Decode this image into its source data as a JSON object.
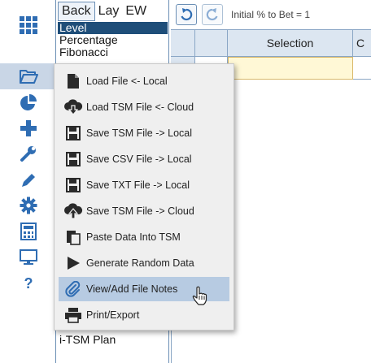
{
  "left_toolbar": {
    "icons": [
      "apps-grid-icon",
      "folder-open-icon",
      "pie-chart-icon",
      "plus-icon",
      "wrench-icon",
      "pencil-icon",
      "gear-icon",
      "calculator-icon",
      "monitor-icon",
      "help-icon"
    ]
  },
  "mode_tabs": {
    "back": "Back",
    "lay": "Lay",
    "ew": "EW"
  },
  "sizing_options": [
    "Level",
    "Percentage",
    "Fibonacci"
  ],
  "sizing_selected": "Level",
  "plan_label": "i-TSM Plan",
  "top_bar": {
    "bet_label": "Initial % to Bet = 1"
  },
  "grid": {
    "header_selection": "Selection",
    "header_next": "C"
  },
  "file_menu": {
    "items": [
      {
        "label": "Load File <- Local",
        "icon": "file-icon"
      },
      {
        "label": "Load TSM File <- Cloud",
        "icon": "cloud-download-icon"
      },
      {
        "label": "Save TSM File -> Local",
        "icon": "save-disk-icon"
      },
      {
        "label": "Save CSV File -> Local",
        "icon": "save-disk-icon"
      },
      {
        "label": "Save TXT File -> Local",
        "icon": "save-disk-icon"
      },
      {
        "label": "Save TSM File -> Cloud",
        "icon": "cloud-upload-icon"
      },
      {
        "label": "Paste Data Into TSM",
        "icon": "paste-icon"
      },
      {
        "label": "Generate Random Data",
        "icon": "play-triangle-icon"
      },
      {
        "label": "View/Add File Notes",
        "icon": "paperclip-icon"
      },
      {
        "label": "Print/Export",
        "icon": "printer-icon"
      }
    ],
    "hovered": "View/Add File Notes"
  },
  "colors": {
    "accent": "#1f4e79",
    "menu_hover": "#b7cbe2",
    "grid_header": "#dce6f1",
    "row_highlight": "#fff8d6"
  }
}
